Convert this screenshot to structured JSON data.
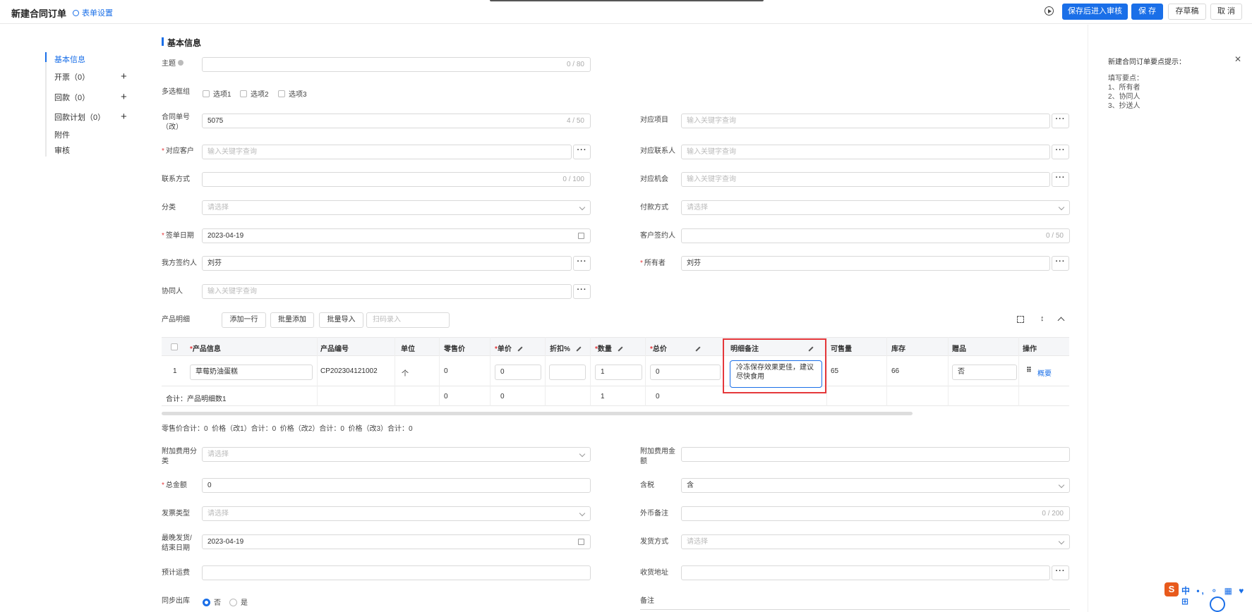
{
  "header": {
    "title": "新建合同订单",
    "form_settings": "表单设置",
    "btn_save_submit": "保存后进入审核",
    "btn_save": "保 存",
    "btn_draft": "存草稿",
    "btn_cancel": "取 消"
  },
  "sidenav": {
    "items": [
      {
        "label": "基本信息"
      },
      {
        "label": "开票（0）"
      },
      {
        "label": "回款（0）"
      },
      {
        "label": "回款计划（0）"
      },
      {
        "label": "附件"
      },
      {
        "label": "审核"
      }
    ]
  },
  "section": {
    "title": "基本信息"
  },
  "form": {
    "subject": {
      "label": "主题",
      "value": "",
      "count": "0 / 80"
    },
    "multi": {
      "label": "多选框组",
      "options": [
        "选项1",
        "选项2",
        "选项3"
      ]
    },
    "contract_no": {
      "label_1": "合同单号",
      "label_2": "（改）",
      "value": "5075",
      "count": "4 / 50"
    },
    "project": {
      "label": "对应项目",
      "placeholder": "输入关键字查询"
    },
    "customer": {
      "label": "对应客户",
      "placeholder": "输入关键字查询"
    },
    "contact": {
      "label": "对应联系人",
      "placeholder": "输入关键字查询"
    },
    "phone": {
      "label": "联系方式",
      "count": "0 / 100"
    },
    "opportunity": {
      "label": "对应机会",
      "placeholder": "输入关键字查询"
    },
    "category": {
      "label": "分类",
      "placeholder": "请选择"
    },
    "payment": {
      "label": "付款方式",
      "placeholder": "请选择"
    },
    "sign_date": {
      "label": "签单日期",
      "value": "2023-04-19"
    },
    "customer_signer": {
      "label": "客户签约人",
      "count": "0 / 50"
    },
    "our_signer": {
      "label": "我方签约人",
      "value": "刘芬"
    },
    "owner": {
      "label": "所有者",
      "value": "刘芬"
    },
    "collaborator": {
      "label": "协同人",
      "placeholder": "输入关键字查询"
    },
    "product_detail": {
      "label": "产品明细",
      "btn_add_row": "添加一行",
      "btn_batch_add": "批量添加",
      "btn_batch_import": "批量导入",
      "scan_placeholder": "扫码录入"
    }
  },
  "table": {
    "headers": [
      "产品信息",
      "产品编号",
      "单位",
      "零售价",
      "单价",
      "折扣%",
      "数量",
      "总价",
      "明细备注",
      "可售量",
      "库存",
      "赠品",
      "操作"
    ],
    "row": {
      "index": "1",
      "product": "草莓奶油蛋糕",
      "code": "CP202304121002",
      "unit": "个",
      "retail": "0",
      "price": "0",
      "discount": "",
      "qty": "1",
      "total": "0",
      "note": "冷冻保存效果更佳，建议尽快食用",
      "available": "65",
      "stock": "66",
      "gift": "否",
      "action": "概要"
    },
    "summary": {
      "label": "合计：产品明细数1",
      "retail": "0",
      "price": "0",
      "qty": "1",
      "total": "0"
    }
  },
  "totals_line": "零售价合计：0  价格（改1）合计：0  价格（改2）合计：0  价格（改3）合计：0",
  "form2": {
    "extra_fee_cat": {
      "label_1": "附加费用分",
      "label_2": "类",
      "placeholder": "请选择"
    },
    "extra_fee_amt": {
      "label_1": "附加费用金",
      "label_2": "额",
      "value": ""
    },
    "total_amount": {
      "label": "总金额",
      "value": "0"
    },
    "tax": {
      "label": "含税",
      "value": "含"
    },
    "invoice_type": {
      "label": "发票类型",
      "placeholder": "请选择"
    },
    "fx_note": {
      "label": "外币备注",
      "count": "0 / 200"
    },
    "last_ship": {
      "label_1": "最晚发货/",
      "label_2": "结束日期",
      "value": "2023-04-19"
    },
    "ship_method": {
      "label": "发货方式",
      "placeholder": "请选择"
    },
    "est_freight": {
      "label": "预计运费",
      "value": ""
    },
    "ship_address": {
      "label": "收货地址",
      "value": ""
    },
    "sync_out": {
      "label": "同步出库",
      "opt_no": "否",
      "opt_yes": "是"
    },
    "remark": {
      "label": "备注"
    }
  },
  "tips": {
    "title": "新建合同订单要点提示：",
    "heading": "填写要点：",
    "lines": [
      "1、所有者",
      "2、协同人",
      "3、抄送人"
    ]
  },
  "ime": {
    "text": "中 •, ⚬ ▦ ♥ ⊞"
  }
}
